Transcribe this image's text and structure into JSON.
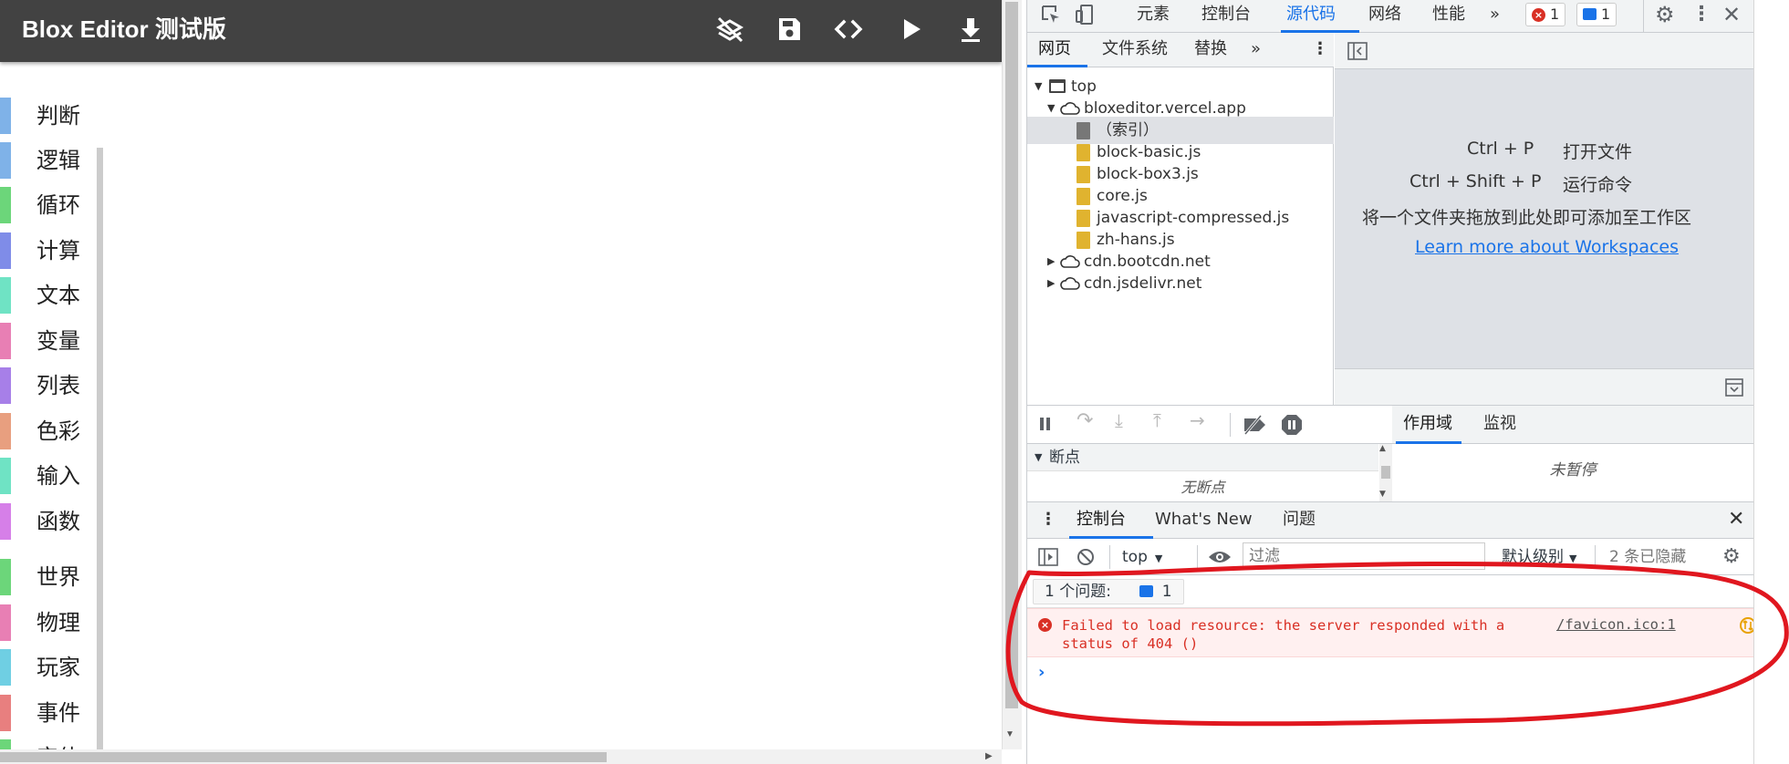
{
  "app": {
    "title": "Blox Editor 测试版",
    "header_actions": [
      {
        "name": "layers-off-icon"
      },
      {
        "name": "save-icon"
      },
      {
        "name": "code-icon"
      },
      {
        "name": "run-icon"
      },
      {
        "name": "download-icon"
      }
    ],
    "categories": [
      {
        "label": "判断",
        "color": "#7fb2e8"
      },
      {
        "label": "逻辑",
        "color": "#7fb2e8"
      },
      {
        "label": "循环",
        "color": "#6cd67a"
      },
      {
        "label": "计算",
        "color": "#7f8ce8"
      },
      {
        "label": "文本",
        "color": "#6fe3c4"
      },
      {
        "label": "变量",
        "color": "#e87fb4"
      },
      {
        "label": "列表",
        "color": "#a77fe8"
      },
      {
        "label": "色彩",
        "color": "#e89f7f"
      },
      {
        "label": "输入",
        "color": "#6fe3c4"
      },
      {
        "label": "函数",
        "color": "#d67fe8"
      },
      {
        "label": "世界",
        "color": "#6cd67a"
      },
      {
        "label": "物理",
        "color": "#e87fb4"
      },
      {
        "label": "玩家",
        "color": "#6fcfe3"
      },
      {
        "label": "事件",
        "color": "#e87f7f"
      },
      {
        "label": "实体",
        "color": "#6cd67a"
      }
    ]
  },
  "devtools": {
    "top_tabs": [
      "元素",
      "控制台",
      "源代码",
      "网络",
      "性能"
    ],
    "active_top_tab": "源代码",
    "more_tabs": "»",
    "error_count": "1",
    "message_count": "1",
    "navigator": {
      "tabs": [
        "网页",
        "文件系统",
        "替换"
      ],
      "more": "»",
      "tree": [
        {
          "label": "top",
          "level": 0,
          "icon": "frame-icon",
          "expanded": true
        },
        {
          "label": "bloxeditor.vercel.app",
          "level": 1,
          "icon": "cloud-icon",
          "expanded": true
        },
        {
          "label": "（索引）",
          "level": 2,
          "icon": "document-icon",
          "selected": true
        },
        {
          "label": "block-basic.js",
          "level": 2,
          "icon": "js-file-icon"
        },
        {
          "label": "block-box3.js",
          "level": 2,
          "icon": "js-file-icon"
        },
        {
          "label": "core.js",
          "level": 2,
          "icon": "js-file-icon"
        },
        {
          "label": "javascript-compressed.js",
          "level": 2,
          "icon": "js-file-icon"
        },
        {
          "label": "zh-hans.js",
          "level": 2,
          "icon": "js-file-icon"
        },
        {
          "label": "cdn.bootcdn.net",
          "level": 1,
          "icon": "cloud-icon",
          "expanded": false
        },
        {
          "label": "cdn.jsdelivr.net",
          "level": 1,
          "icon": "cloud-icon",
          "expanded": false
        }
      ]
    },
    "editor_placeholder": {
      "shortcuts": [
        {
          "keys": "Ctrl + P",
          "action": "打开文件"
        },
        {
          "keys": "Ctrl + Shift + P",
          "action": "运行命令"
        }
      ],
      "hint": "将一个文件夹拖放到此处即可添加至工作区",
      "link": "Learn more about Workspaces"
    },
    "debugger": {
      "breakpoints_title": "断点",
      "no_breakpoints": "无断点",
      "scope_tabs": [
        "作用域",
        "监视"
      ],
      "not_paused": "未暂停"
    },
    "drawer": {
      "tabs": [
        "控制台",
        "What's New",
        "问题"
      ],
      "context": "top",
      "filter_placeholder": "过滤",
      "level": "默认级别",
      "hidden_count": "2 条已隐藏",
      "issues_label": "1 个问题:",
      "issues_count": "1",
      "error_message": "Failed to load resource: the server responded with a status of 404 ()",
      "error_source": "/favicon.ico:1",
      "prompt": "›"
    }
  },
  "colors": {
    "header_bg": "#424242",
    "accent": "#1a73e8",
    "error": "#d93025",
    "annotation": "#e0171f"
  }
}
